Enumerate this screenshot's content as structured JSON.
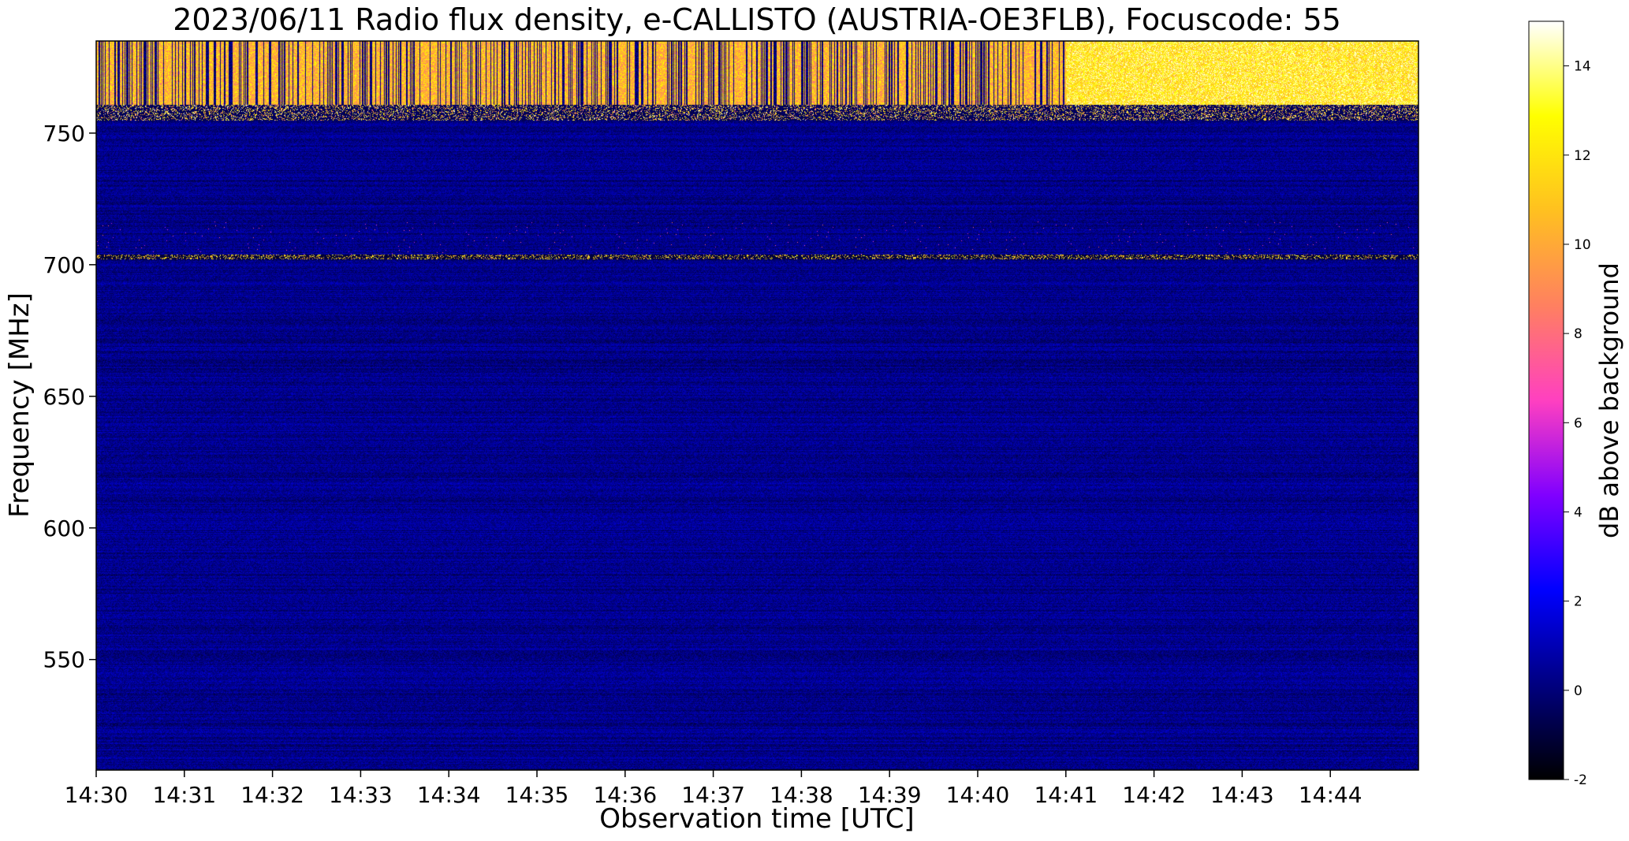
{
  "chart_data": {
    "type": "heatmap",
    "title": "2023/06/11  Radio flux density, e-CALLISTO (AUSTRIA-OE3FLB), Focuscode: 55",
    "xlabel": "Observation time [UTC]",
    "ylabel": "Frequency [MHz]",
    "x_ticks": [
      "14:30",
      "14:31",
      "14:32",
      "14:33",
      "14:34",
      "14:35",
      "14:36",
      "14:37",
      "14:38",
      "14:39",
      "14:40",
      "14:41",
      "14:42",
      "14:43",
      "14:44"
    ],
    "xlim": [
      "14:30",
      "14:45"
    ],
    "y_ticks": [
      550,
      600,
      650,
      700,
      750
    ],
    "ylim": [
      508,
      785
    ],
    "colorbar": {
      "label": "dB above background",
      "ticks": [
        -2,
        0,
        2,
        4,
        6,
        8,
        10,
        12,
        14
      ],
      "range": [
        -2,
        15
      ],
      "colors": [
        "#000000",
        "#000080",
        "#0000ff",
        "#8000ff",
        "#ff40c0",
        "#ff8060",
        "#ffc020",
        "#ffff00",
        "#ffffff"
      ]
    },
    "features": {
      "background_db": 0.3,
      "rfi_band_mhz": [
        755,
        785
      ],
      "rfi_band_db": 13,
      "bright_block_start": "14:41",
      "bright_block_db": 15,
      "narrow_line_mhz": 703,
      "narrow_line_db": 9
    }
  }
}
